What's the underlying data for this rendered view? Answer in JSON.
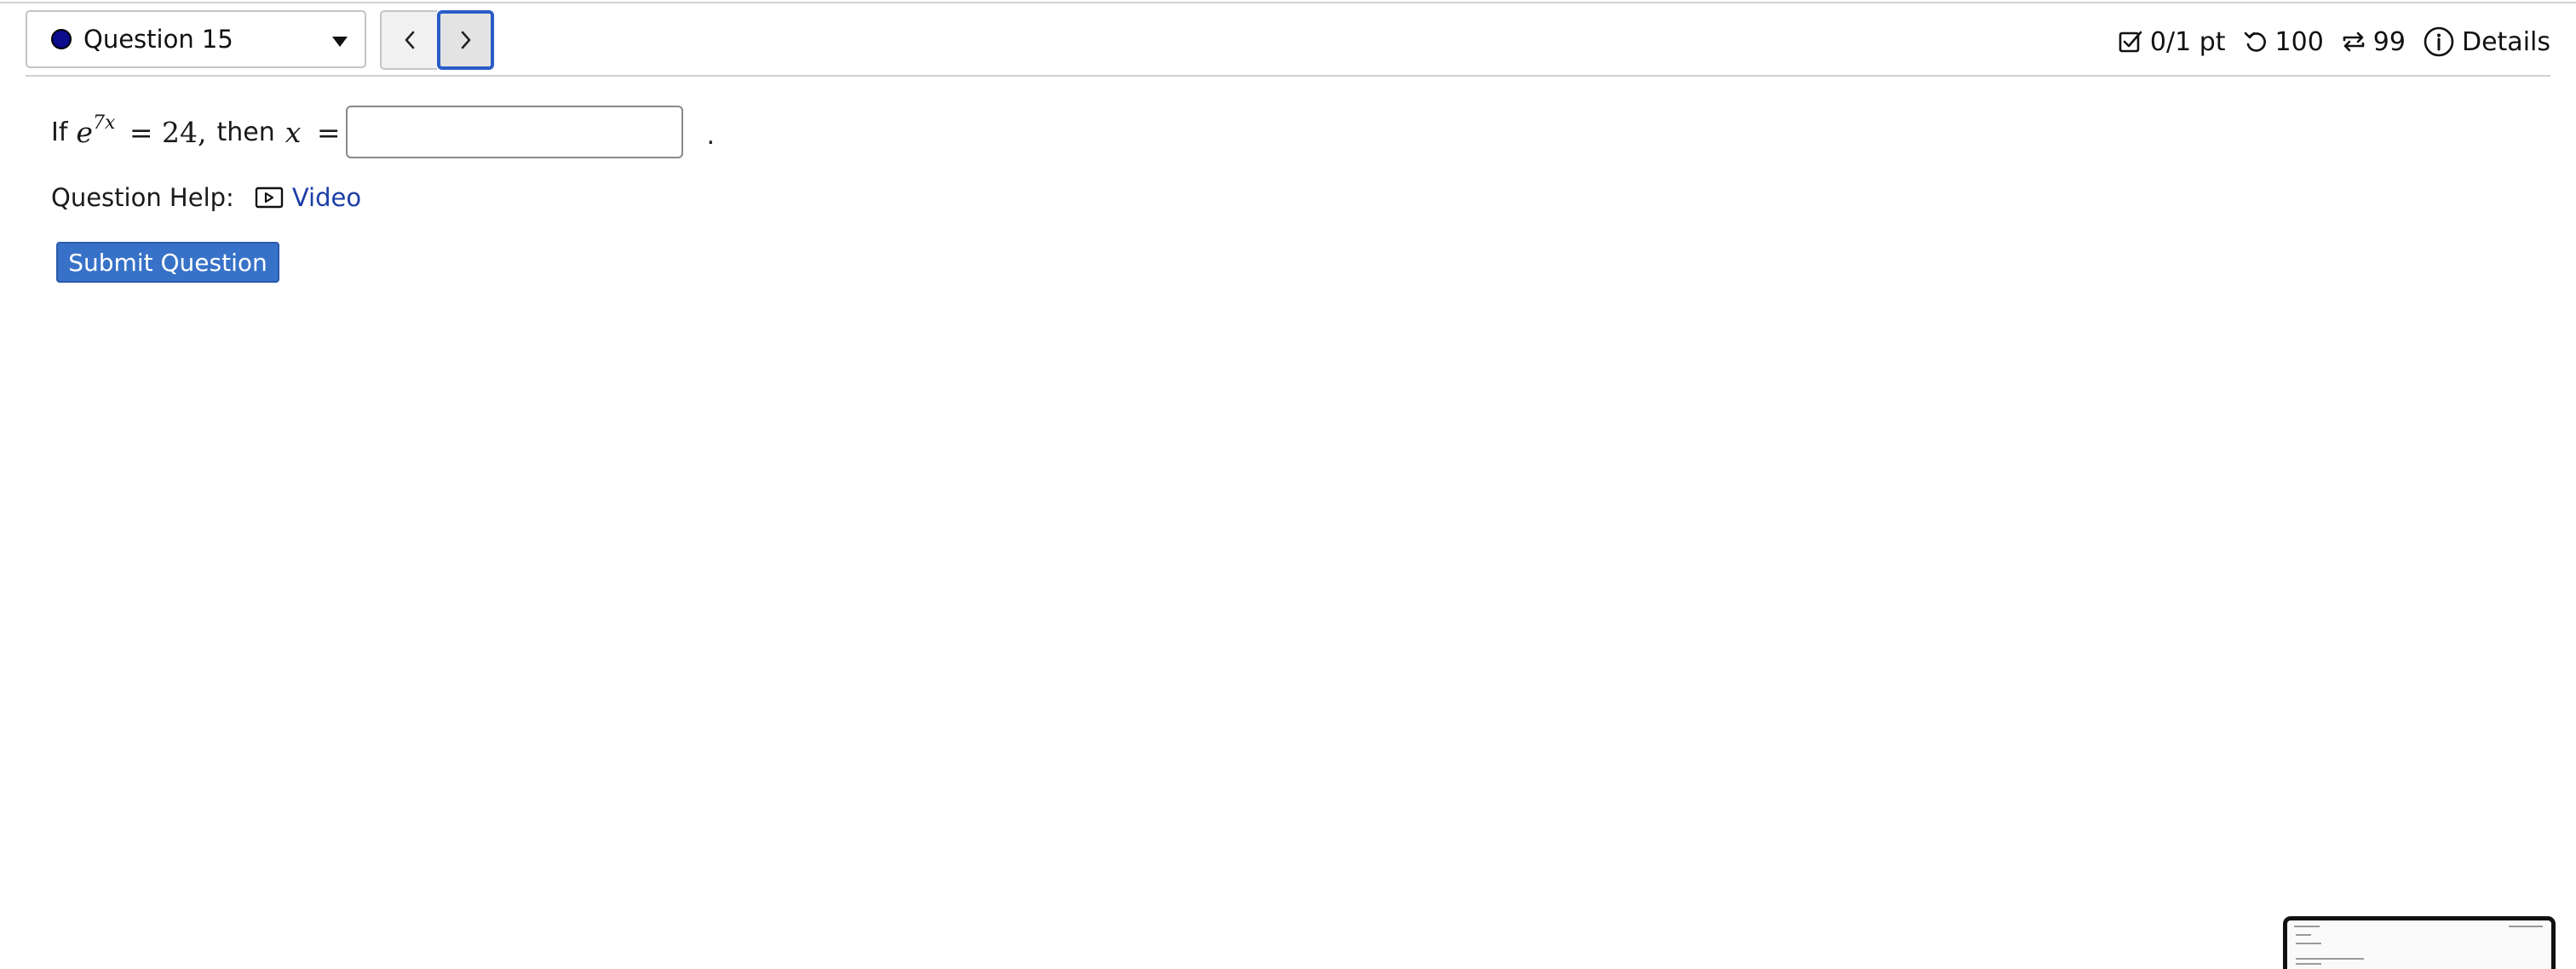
{
  "question_select": {
    "label": "Question 15",
    "status_color": "#0c0c8c"
  },
  "nav": {
    "prev_label": "‹",
    "next_label": "›"
  },
  "status": {
    "score": "0/1 pt",
    "attempts": "100",
    "retries": "99",
    "details": "Details"
  },
  "question": {
    "prefix": "If",
    "math_base": "e",
    "math_exponent": "7x",
    "math_rhs": "= 24,",
    "then_word": "then",
    "math_var": "x",
    "math_eq": "=",
    "answer_value": "",
    "suffix": "."
  },
  "help": {
    "label": "Question Help:",
    "video_label": "Video"
  },
  "submit": {
    "label": "Submit Question"
  },
  "colors": {
    "accent": "#3872c8",
    "link": "#1a3da8",
    "focus": "#2a5cc7"
  }
}
